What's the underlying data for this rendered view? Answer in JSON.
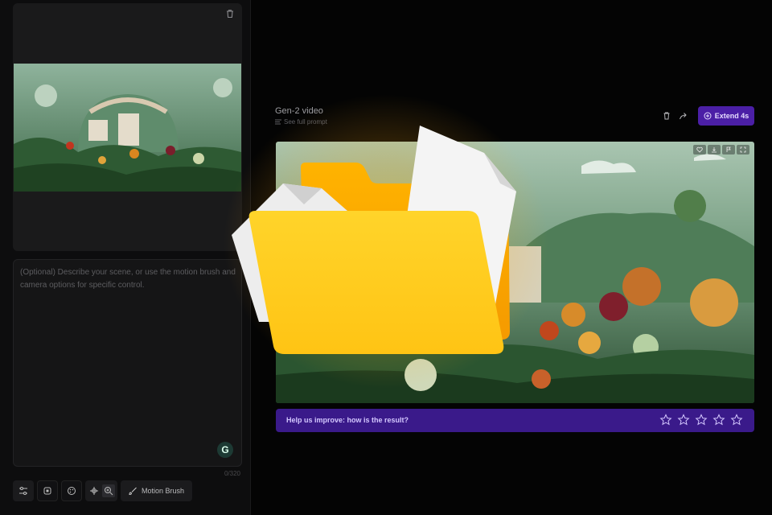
{
  "left": {
    "prompt_placeholder": "(Optional) Describe your scene, or use the motion brush and camera options for specific control.",
    "char_count": "0/320",
    "toolbar": {
      "motion_brush_label": "Motion Brush"
    }
  },
  "video": {
    "title": "Gen-2 video",
    "see_prompt": "See full prompt",
    "extend_label": "Extend 4s"
  },
  "feedback": {
    "question": "Help us improve: how is the result?",
    "stars": 5
  },
  "colors": {
    "accent": "#4b1fa6",
    "feedback_bg": "#3a1a8a",
    "folder": "#ffc61a"
  }
}
